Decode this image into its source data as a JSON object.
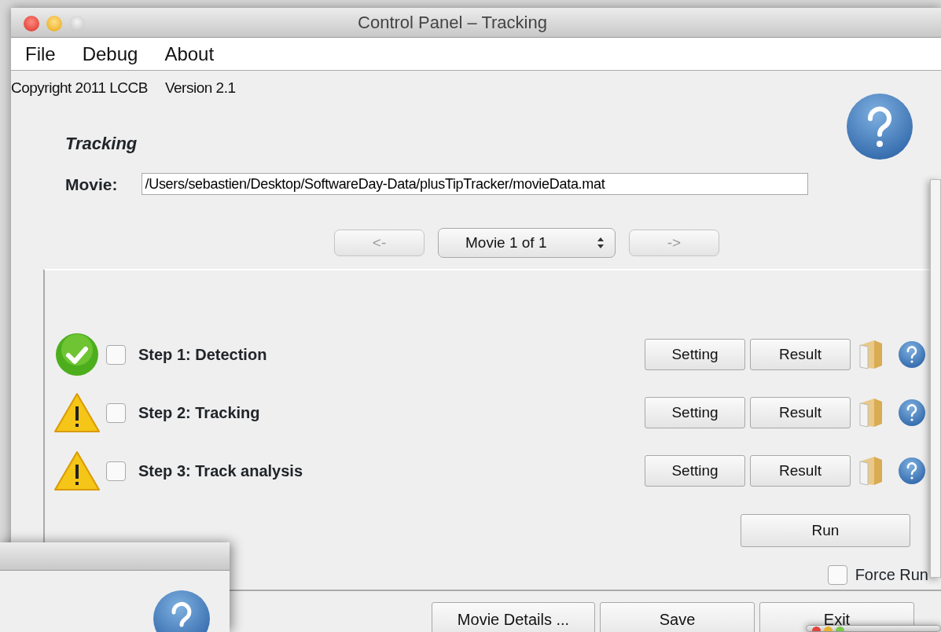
{
  "window": {
    "title": "Control Panel – Tracking"
  },
  "menu": [
    "File",
    "Debug",
    "About"
  ],
  "copyright": "Copyright 2011 LCCB",
  "version": "Version 2.1",
  "section_title": "Tracking",
  "movie": {
    "label": "Movie:",
    "value": "/Users/sebastien/Desktop/SoftwareDay-Data/plusTipTracker/movieData.mat"
  },
  "navigation": {
    "previous": {
      "label": "<-",
      "disabled": true
    },
    "selector": "Movie 1 of 1",
    "next": {
      "label": "->",
      "disabled": true
    }
  },
  "steps": [
    {
      "kind": "done",
      "checked": false,
      "label": "Step 1: Detection",
      "setting": "Setting",
      "result": "Result"
    },
    {
      "kind": "warning",
      "checked": false,
      "label": "Step 2: Tracking",
      "setting": "Setting",
      "result": "Result"
    },
    {
      "kind": "warning",
      "checked": false,
      "label": "Step 3: Track analysis",
      "setting": "Setting",
      "result": "Result"
    }
  ],
  "run_button": "Run",
  "force_run": {
    "label": "Force Run",
    "checked": false
  },
  "footer_buttons": [
    "Movie Details ...",
    "Save",
    "Exit"
  ]
}
